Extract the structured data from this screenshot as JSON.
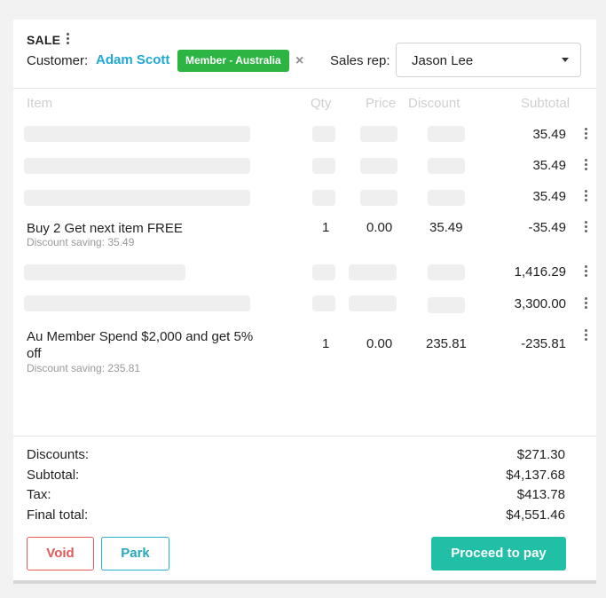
{
  "header": {
    "title": "SALE",
    "customer_label": "Customer:",
    "customer_name": "Adam Scott",
    "member_badge": "Member - Australia",
    "remove_icon": "×",
    "sales_rep_label": "Sales rep:",
    "sales_rep_value": "Jason Lee"
  },
  "columns": {
    "item": "Item",
    "qty": "Qty",
    "price": "Price",
    "discount": "Discount",
    "subtotal": "Subtotal"
  },
  "rows": [
    {
      "subtotal": "35.49"
    },
    {
      "subtotal": "35.49"
    },
    {
      "subtotal": "35.49"
    },
    {
      "name": "Buy 2 Get next item FREE",
      "saving": "Discount saving: 35.49",
      "qty": "1",
      "price": "0.00",
      "discount": "35.49",
      "subtotal": "-35.49"
    },
    {
      "subtotal": "1,416.29"
    },
    {
      "subtotal": "3,300.00"
    },
    {
      "name": "Au Member Spend $2,000 and get 5% off",
      "saving": "Discount saving: 235.81",
      "qty": "1",
      "price": "0.00",
      "discount": "235.81",
      "subtotal": "-235.81"
    }
  ],
  "totals": {
    "discounts_label": "Discounts:",
    "discounts": "$271.30",
    "subtotal_label": "Subtotal:",
    "subtotal": "$4,137.68",
    "tax_label": "Tax:",
    "tax": "$413.78",
    "final_label": "Final total:",
    "final": "$4,551.46"
  },
  "actions": {
    "void": "Void",
    "park": "Park",
    "pay": "Proceed to pay"
  },
  "colors": {
    "customer": "#1fa8d6",
    "badge": "#2db544",
    "void": "#e05a5a",
    "park": "#26a8bd",
    "pay": "#21bfa6"
  },
  "icons": {
    "menu": "kebab-icon",
    "dropdown": "chevron-down-icon",
    "remove": "close-icon"
  }
}
